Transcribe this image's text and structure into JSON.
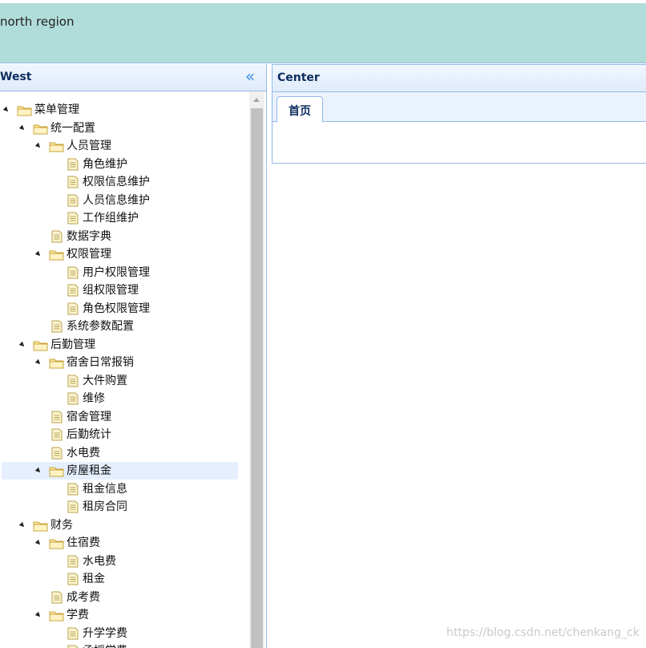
{
  "north": {
    "text": "north region"
  },
  "west": {
    "title": "West",
    "collapse_glyph": "«"
  },
  "center": {
    "title": "Center",
    "tabs": [
      {
        "label": "首页"
      }
    ]
  },
  "tree": [
    {
      "label": "菜单管理",
      "type": "folder",
      "level": 0,
      "expanded": true
    },
    {
      "label": "统一配置",
      "type": "folder",
      "level": 1,
      "expanded": true
    },
    {
      "label": "人员管理",
      "type": "folder",
      "level": 2,
      "expanded": true
    },
    {
      "label": "角色维护",
      "type": "file",
      "level": 3
    },
    {
      "label": "权限信息维护",
      "type": "file",
      "level": 3
    },
    {
      "label": "人员信息维护",
      "type": "file",
      "level": 3
    },
    {
      "label": "工作组维护",
      "type": "file",
      "level": 3
    },
    {
      "label": "数据字典",
      "type": "file",
      "level": 2
    },
    {
      "label": "权限管理",
      "type": "folder",
      "level": 2,
      "expanded": true
    },
    {
      "label": "用户权限管理",
      "type": "file",
      "level": 3
    },
    {
      "label": "组权限管理",
      "type": "file",
      "level": 3
    },
    {
      "label": "角色权限管理",
      "type": "file",
      "level": 3
    },
    {
      "label": "系统参数配置",
      "type": "file",
      "level": 2
    },
    {
      "label": "后勤管理",
      "type": "folder",
      "level": 1,
      "expanded": true
    },
    {
      "label": "宿舍日常报销",
      "type": "folder",
      "level": 2,
      "expanded": true
    },
    {
      "label": "大件购置",
      "type": "file",
      "level": 3
    },
    {
      "label": "维修",
      "type": "file",
      "level": 3
    },
    {
      "label": "宿舍管理",
      "type": "file",
      "level": 2
    },
    {
      "label": "后勤统计",
      "type": "file",
      "level": 2
    },
    {
      "label": "水电费",
      "type": "file",
      "level": 2
    },
    {
      "label": "房屋租金",
      "type": "folder",
      "level": 2,
      "expanded": true,
      "selected": true
    },
    {
      "label": "租金信息",
      "type": "file",
      "level": 3
    },
    {
      "label": "租房合同",
      "type": "file",
      "level": 3
    },
    {
      "label": "财务",
      "type": "folder",
      "level": 1,
      "expanded": true
    },
    {
      "label": "住宿费",
      "type": "folder",
      "level": 2,
      "expanded": true
    },
    {
      "label": "水电费",
      "type": "file",
      "level": 3
    },
    {
      "label": "租金",
      "type": "file",
      "level": 3
    },
    {
      "label": "成考费",
      "type": "file",
      "level": 2
    },
    {
      "label": "学费",
      "type": "folder",
      "level": 2,
      "expanded": true
    },
    {
      "label": "升学学费",
      "type": "file",
      "level": 3
    },
    {
      "label": "函授学费",
      "type": "file",
      "level": 3
    }
  ],
  "watermark": "https://blog.csdn.net/chenkang_ck",
  "colors": {
    "north_bg": "#b0ddd9",
    "panel_border": "#95b8e7",
    "header_title": "#0e2d5f",
    "selected_row": "#e6effd",
    "folder_fill": "#fce79a",
    "folder_stroke": "#c9a43c",
    "file_fill": "#fbf4d2",
    "file_stroke": "#b8a24a"
  }
}
